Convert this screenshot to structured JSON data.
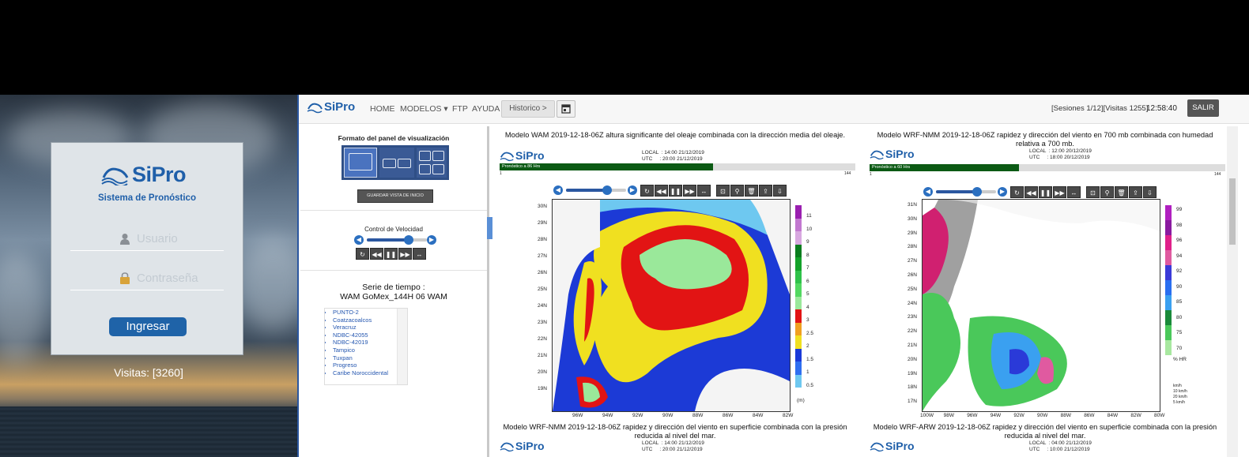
{
  "login": {
    "logo_text": "SiPro",
    "subtitle": "Sistema de Pronóstico",
    "username_placeholder": "Usuario",
    "password_placeholder": "Contraseña",
    "submit_label": "Ingresar",
    "visits": "Visitas: [3260]"
  },
  "navbar": {
    "logo_text": "SiPro",
    "items": [
      "HOME",
      "MODELOS ▾",
      "FTP",
      "AYUDA"
    ],
    "history_label": "Historico >",
    "sessions": "[Sesiones 1/12][Visitas 1255]",
    "time": "12:58:40",
    "logout_label": "SALIR",
    "calendar_icon": "calendar-icon"
  },
  "sidebar": {
    "layout_header": "Formato del panel de visualización",
    "save_view_label": "GUARDAR VISTA DE INICIO",
    "speed_label": "Control de Velocidad",
    "speed_level": 0.7,
    "series_title_line1": "Serie de tiempo :",
    "series_title_line2": "WAM GoMex_144H 06 WAM",
    "stations": [
      "PUNTO-2",
      "Coatzacoalcos",
      "Veracruz",
      "NDBC-42055",
      "NDBC-42019",
      "Tampico",
      "Tuxpan",
      "Progreso",
      "Caribe Noroccidental"
    ]
  },
  "panels": [
    {
      "title": "Modelo WAM 2019-12-18-06Z altura significante del oleaje combinada con la dirección media del oleaje.",
      "logo_text": "SiPro",
      "local": "LOCAL  : 14:00 21/12/2019",
      "utc": "UTC     : 20:00 21/12/2019",
      "bar_label": "Pronóstico a 86 Hrs",
      "bar_progress": 0.6,
      "bar_start": "1",
      "bar_end": "144",
      "lat_labels": [
        "30N",
        "29N",
        "28N",
        "27N",
        "26N",
        "25N",
        "24N",
        "23N",
        "22N",
        "21N",
        "20N",
        "19N"
      ],
      "lon_labels": [
        "96W",
        "94W",
        "92W",
        "90W",
        "88W",
        "86W",
        "84W",
        "82W"
      ],
      "colorbar": [
        {
          "label": "11",
          "color": "#9a1fb0"
        },
        {
          "label": "10",
          "color": "#c278d0"
        },
        {
          "label": "9",
          "color": "#d8a8e0"
        },
        {
          "label": "8",
          "color": "#0a7d1e"
        },
        {
          "label": "7",
          "color": "#14a22a"
        },
        {
          "label": "6",
          "color": "#2fc24a"
        },
        {
          "label": "5",
          "color": "#52d860"
        },
        {
          "label": "4",
          "color": "#9ae89a"
        },
        {
          "label": "3",
          "color": "#e21414"
        },
        {
          "label": "2.5",
          "color": "#f0a020"
        },
        {
          "label": "2",
          "color": "#f0e020"
        },
        {
          "label": "1.5",
          "color": "#1a3ad8"
        },
        {
          "label": "1",
          "color": "#2f6ff0"
        },
        {
          "label": "0.5",
          "color": "#6ec8f0"
        }
      ],
      "unit": "(m)"
    },
    {
      "title": "Modelo WRF-NMM 2019-12-18-06Z rapidez y dirección del viento en 700 mb combinada con humedad relativa a 700 mb.",
      "logo_text": "SiPro",
      "local": "LOCAL  : 12:00 20/12/2019",
      "utc": "UTC     : 18:00 20/12/2019",
      "bar_label": "Pronóstico a 60 Hrs",
      "bar_progress": 0.42,
      "bar_start": "1",
      "bar_end": "144",
      "lat_labels": [
        "31N",
        "30N",
        "29N",
        "28N",
        "27N",
        "26N",
        "25N",
        "24N",
        "23N",
        "22N",
        "21N",
        "20N",
        "19N",
        "18N",
        "17N"
      ],
      "lon_labels": [
        "100W",
        "98W",
        "96W",
        "94W",
        "92W",
        "90W",
        "88W",
        "86W",
        "84W",
        "82W",
        "80W"
      ],
      "colorbar": [
        {
          "label": "99",
          "color": "#b020c0"
        },
        {
          "label": "98",
          "color": "#8a1aa0"
        },
        {
          "label": "96",
          "color": "#e0208a"
        },
        {
          "label": "94",
          "color": "#e05aa0"
        },
        {
          "label": "92",
          "color": "#3a3ad8"
        },
        {
          "label": "90",
          "color": "#2a6ff0"
        },
        {
          "label": "85",
          "color": "#3aa0f0"
        },
        {
          "label": "80",
          "color": "#1a8a3a"
        },
        {
          "label": "75",
          "color": "#4ac85a"
        },
        {
          "label": "70",
          "color": "#a8e8a0"
        }
      ],
      "unit": "% HR",
      "legend_wind": [
        "km/h",
        "10 km/h",
        "20 km/h",
        "5 km/h"
      ]
    },
    {
      "title": "Modelo WRF-NMM 2019-12-18-06Z rapidez y dirección del viento en superficie combinada con la presión reducida al nivel del mar.",
      "logo_text": "SiPro",
      "local": "LOCAL  : 14:00 21/12/2019",
      "utc": "UTC     : 20:00 21/12/2019"
    },
    {
      "title": "Modelo WRF-ARW 2019-12-18-06Z rapidez y dirección del viento en superficie combinada con la presión reducida al nivel del mar.",
      "logo_text": "SiPro",
      "local": "LOCAL  : 04:00 21/12/2019",
      "utc": "UTC     : 10:00 21/12/2019"
    }
  ],
  "toolbar_icons": [
    "play-back-icon",
    "refresh-icon",
    "rewind-icon",
    "pause-icon",
    "fast-forward-icon",
    "expand-icon",
    "zoom-icon",
    "map-pin-icon",
    "delete-icon",
    "upload-icon",
    "download-icon"
  ],
  "colors": {
    "brand": "#1f5fa9",
    "accent": "#2b6fc0",
    "bar_green": "#0b5a14"
  }
}
